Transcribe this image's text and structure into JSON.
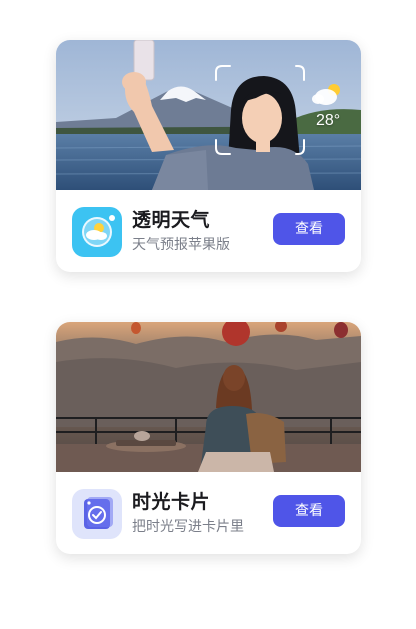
{
  "cards": [
    {
      "app_name": "透明天气",
      "app_desc": "天气预报苹果版",
      "button_label": "查看",
      "weather_temp": "28°",
      "icon": "weather-app-icon",
      "photo": "selfie-mountain-lake-photo"
    },
    {
      "app_name": "时光卡片",
      "app_desc": "把时光写进卡片里",
      "button_label": "查看",
      "icon": "time-card-app-icon",
      "photo": "rooftop-balloons-photo"
    }
  ],
  "colors": {
    "button": "#4f55e8",
    "title_text": "#1b1b1f",
    "desc_text": "#7b7f8a",
    "weather_icon_bg": "#3cc3f2",
    "timecard_icon_bg": "#dfe4fb"
  }
}
